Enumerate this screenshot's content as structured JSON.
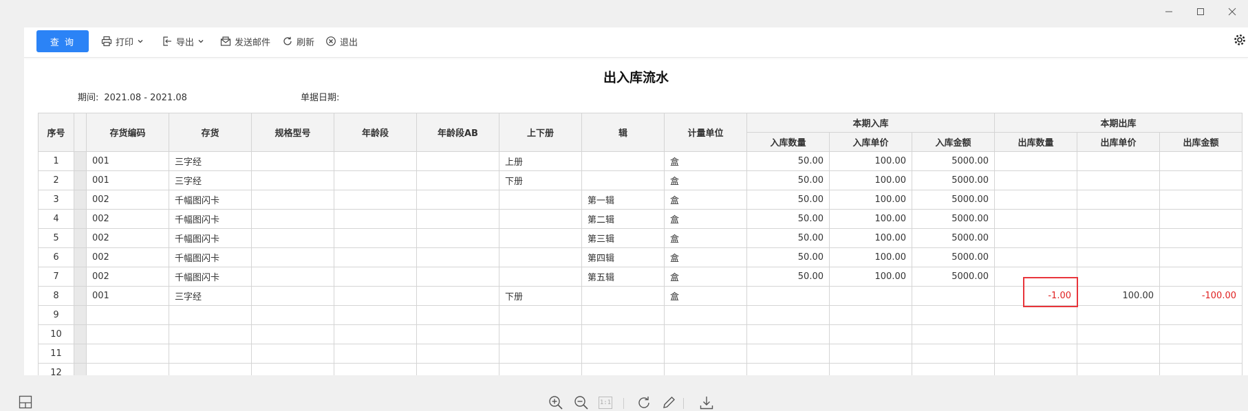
{
  "window": {
    "minimize_icon": "minimize-icon",
    "maximize_icon": "maximize-icon",
    "close_icon": "close-icon"
  },
  "toolbar": {
    "query_label": "查 询",
    "print_label": "打印",
    "export_label": "导出",
    "email_label": "发送邮件",
    "refresh_label": "刷新",
    "exit_label": "退出"
  },
  "report": {
    "title": "出入库流水",
    "period_label": "期间:",
    "period_value": "2021.08 - 2021.08",
    "docdate_label": "单据日期:"
  },
  "table": {
    "headers": {
      "seq": "序号",
      "code": "存货编码",
      "item": "存货",
      "spec": "规格型号",
      "age": "年龄段",
      "age_ab": "年龄段AB",
      "volume": "上下册",
      "series": "辑",
      "unit": "计量单位",
      "in_group": "本期入库",
      "in_qty": "入库数量",
      "in_price": "入库单价",
      "in_amount": "入库金额",
      "out_group": "本期出库",
      "out_qty": "出库数量",
      "out_price": "出库单价",
      "out_amount": "出库金额"
    },
    "rows": [
      {
        "seq": "1",
        "code": "001",
        "item": "三字经",
        "spec": "",
        "age": "",
        "age_ab": "",
        "volume": "上册",
        "series": "",
        "unit": "盒",
        "in_qty": "50.00",
        "in_price": "100.00",
        "in_amount": "5000.00",
        "out_qty": "",
        "out_price": "",
        "out_amount": ""
      },
      {
        "seq": "2",
        "code": "001",
        "item": "三字经",
        "spec": "",
        "age": "",
        "age_ab": "",
        "volume": "下册",
        "series": "",
        "unit": "盒",
        "in_qty": "50.00",
        "in_price": "100.00",
        "in_amount": "5000.00",
        "out_qty": "",
        "out_price": "",
        "out_amount": ""
      },
      {
        "seq": "3",
        "code": "002",
        "item": "千幅图闪卡",
        "spec": "",
        "age": "",
        "age_ab": "",
        "volume": "",
        "series": "第一辑",
        "unit": "盒",
        "in_qty": "50.00",
        "in_price": "100.00",
        "in_amount": "5000.00",
        "out_qty": "",
        "out_price": "",
        "out_amount": ""
      },
      {
        "seq": "4",
        "code": "002",
        "item": "千幅图闪卡",
        "spec": "",
        "age": "",
        "age_ab": "",
        "volume": "",
        "series": "第二辑",
        "unit": "盒",
        "in_qty": "50.00",
        "in_price": "100.00",
        "in_amount": "5000.00",
        "out_qty": "",
        "out_price": "",
        "out_amount": ""
      },
      {
        "seq": "5",
        "code": "002",
        "item": "千幅图闪卡",
        "spec": "",
        "age": "",
        "age_ab": "",
        "volume": "",
        "series": "第三辑",
        "unit": "盒",
        "in_qty": "50.00",
        "in_price": "100.00",
        "in_amount": "5000.00",
        "out_qty": "",
        "out_price": "",
        "out_amount": ""
      },
      {
        "seq": "6",
        "code": "002",
        "item": "千幅图闪卡",
        "spec": "",
        "age": "",
        "age_ab": "",
        "volume": "",
        "series": "第四辑",
        "unit": "盒",
        "in_qty": "50.00",
        "in_price": "100.00",
        "in_amount": "5000.00",
        "out_qty": "",
        "out_price": "",
        "out_amount": ""
      },
      {
        "seq": "7",
        "code": "002",
        "item": "千幅图闪卡",
        "spec": "",
        "age": "",
        "age_ab": "",
        "volume": "",
        "series": "第五辑",
        "unit": "盒",
        "in_qty": "50.00",
        "in_price": "100.00",
        "in_amount": "5000.00",
        "out_qty": "",
        "out_price": "",
        "out_amount": ""
      },
      {
        "seq": "8",
        "code": "001",
        "item": "三字经",
        "spec": "",
        "age": "",
        "age_ab": "",
        "volume": "下册",
        "series": "",
        "unit": "盒",
        "in_qty": "",
        "in_price": "",
        "in_amount": "",
        "out_qty": "-1.00",
        "out_price": "100.00",
        "out_amount": "-100.00"
      },
      {
        "seq": "9",
        "code": "",
        "item": "",
        "spec": "",
        "age": "",
        "age_ab": "",
        "volume": "",
        "series": "",
        "unit": "",
        "in_qty": "",
        "in_price": "",
        "in_amount": "",
        "out_qty": "",
        "out_price": "",
        "out_amount": ""
      },
      {
        "seq": "10",
        "code": "",
        "item": "",
        "spec": "",
        "age": "",
        "age_ab": "",
        "volume": "",
        "series": "",
        "unit": "",
        "in_qty": "",
        "in_price": "",
        "in_amount": "",
        "out_qty": "",
        "out_price": "",
        "out_amount": ""
      },
      {
        "seq": "11",
        "code": "",
        "item": "",
        "spec": "",
        "age": "",
        "age_ab": "",
        "volume": "",
        "series": "",
        "unit": "",
        "in_qty": "",
        "in_price": "",
        "in_amount": "",
        "out_qty": "",
        "out_price": "",
        "out_amount": ""
      },
      {
        "seq": "12",
        "code": "",
        "item": "",
        "spec": "",
        "age": "",
        "age_ab": "",
        "volume": "",
        "series": "",
        "unit": "",
        "in_qty": "",
        "in_price": "",
        "in_amount": "",
        "out_qty": "",
        "out_price": "",
        "out_amount": ""
      }
    ]
  },
  "colors": {
    "accent": "#2b83f6",
    "negative": "#e02020",
    "highlight_box": "#e8343a"
  },
  "bottom_bar": {
    "icons": [
      "layout-icon",
      "zoom-in-icon",
      "zoom-out-icon",
      "actual-size-icon",
      "rotate-icon",
      "edit-icon",
      "download-icon"
    ],
    "actual_size_label": "1:1"
  }
}
